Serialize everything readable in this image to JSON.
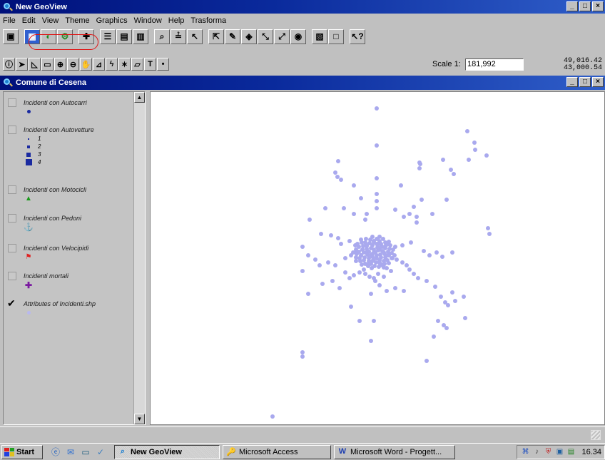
{
  "app": {
    "title": "New GeoView",
    "window_buttons": [
      "_",
      "□",
      "×"
    ]
  },
  "menu": [
    "File",
    "Edit",
    "View",
    "Theme",
    "Graphics",
    "Window",
    "Help",
    "Trasforma"
  ],
  "toolbar1": {
    "icons": [
      "save-icon",
      "table-icon",
      "chart-icon",
      "layout-icon",
      "add-theme-icon",
      "properties-icon",
      "legend-icon",
      "table-props-icon",
      "find-icon",
      "query-icon",
      "locate-icon",
      "open-theme-icon",
      "edit-theme-icon",
      "bar-icon",
      "zoom-extent-icon",
      "zoom-active-icon",
      "zoom-selected-icon",
      "full-icon",
      "clear-icon",
      "help-icon"
    ]
  },
  "toolbar2": {
    "icons": [
      "identify-icon",
      "pointer-icon",
      "vertex-icon",
      "area-icon",
      "zoom-in-icon",
      "zoom-out-icon",
      "pan-icon",
      "measure-icon",
      "hotlink-icon",
      "label-icon",
      "area-label-icon",
      "text-icon",
      "draw-point-icon"
    ],
    "scale_label": "Scale 1:",
    "scale_value": "181,992",
    "coord_x": "49,016.42",
    "coord_y": "43,000.54"
  },
  "view": {
    "title": "Comune di Cesena",
    "window_buttons": [
      "_",
      "□",
      "×"
    ]
  },
  "legend": [
    {
      "title": "Incidenti con Autocarri",
      "checked": false,
      "symbols": [
        {
          "shape": "dot",
          "color": "#1a2aa0",
          "label": ""
        }
      ]
    },
    {
      "title": "Incidenti con Autovetture",
      "checked": false,
      "symbols": [
        {
          "shape": "square",
          "size": 2,
          "color": "#1a2aa0",
          "label": "1"
        },
        {
          "shape": "square",
          "size": 4,
          "color": "#1a2aa0",
          "label": "2"
        },
        {
          "shape": "square",
          "size": 6,
          "color": "#1a2aa0",
          "label": "3"
        },
        {
          "shape": "square",
          "size": 9,
          "color": "#1a2aa0",
          "label": "4"
        }
      ]
    },
    {
      "title": "Incidenti con Motocicli",
      "checked": false,
      "symbols": [
        {
          "shape": "triangle",
          "color": "#1a9a1a",
          "label": ""
        }
      ]
    },
    {
      "title": "Incidenti con Pedoni",
      "checked": false,
      "symbols": [
        {
          "shape": "anchor",
          "color": "#000000",
          "label": ""
        }
      ]
    },
    {
      "title": "Incidenti con Velocipidi",
      "checked": false,
      "symbols": [
        {
          "shape": "flag",
          "color": "#e02020",
          "label": ""
        }
      ]
    },
    {
      "title": "Incidenti mortali",
      "checked": false,
      "symbols": [
        {
          "shape": "plus",
          "color": "#7a1aa0",
          "label": ""
        }
      ]
    },
    {
      "title": "Attributes of Incidenti.shp",
      "checked": true,
      "symbols": [
        {
          "shape": "dot",
          "color": "#b8b8f0",
          "label": ""
        }
      ]
    }
  ],
  "map": {
    "point_color": "#a9a9ee"
  },
  "taskbar": {
    "start_label": "Start",
    "quick_launch": [
      "ie-icon",
      "outlook-icon",
      "desktop-icon",
      "channels-icon"
    ],
    "tasks": [
      {
        "label": "New GeoView",
        "active": true,
        "icon": "geoview-icon"
      },
      {
        "label": "Microsoft Access",
        "active": false,
        "icon": "access-icon"
      },
      {
        "label": "Microsoft Word - Progett...",
        "active": false,
        "icon": "word-icon"
      }
    ],
    "clock": "16.34"
  }
}
